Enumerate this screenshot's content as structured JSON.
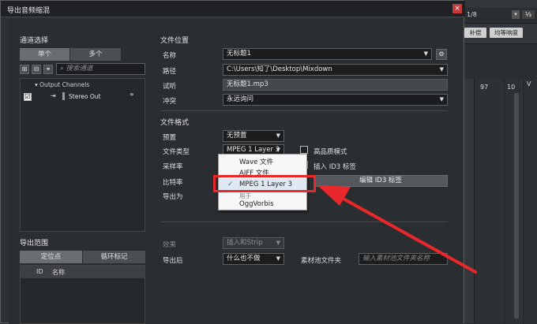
{
  "dialog": {
    "title": "导出音频缩混",
    "close_glyph": "×"
  },
  "channels": {
    "title": "通道选择",
    "mode_single": "单个",
    "mode_multi": "多个",
    "search_placeholder": "搜索通道",
    "tree_root": "Output Channels",
    "item_label": "Stereo Out",
    "item_checked": true
  },
  "range": {
    "title": "导出范围",
    "tab_locators": "定位点",
    "tab_cycle": "循环标记",
    "col_id": "ID",
    "col_name": "名称"
  },
  "location": {
    "title": "文件位置",
    "name_label": "名称",
    "name_value": "无标题1",
    "path_label": "路径",
    "path_value": "C:\\Users\\知了\\Desktop\\Mixdown",
    "preview_label": "试听",
    "preview_value": "无标题1.mp3",
    "conflict_label": "冲突",
    "conflict_value": "永远询问"
  },
  "format": {
    "title": "文件格式",
    "preset_label": "预置",
    "preset_value": "无预置",
    "type_label": "文件类型",
    "type_value": "MPEG 1 Layer 3",
    "hq_label": "高品质模式",
    "samplerate_label": "采样率",
    "id3_label": "插入 ID3 标签",
    "bitrate_label": "比特率",
    "edit_id3_label": "编辑 ID3 标签",
    "export_as_label": "导出为",
    "partial_text": "用于"
  },
  "filetype_menu": {
    "items": [
      "Wave 文件",
      "AIFF 文件",
      "MPEG 1 Layer 3",
      "OggVorbis"
    ],
    "selected_index": 2,
    "check_glyph": "✓"
  },
  "post": {
    "effects_label": "效果",
    "effects_value": "插入和Strip",
    "after_label": "导出后",
    "after_value": "什么也不做",
    "pool_label": "素材池文件夹",
    "pool_placeholder": "输入素材池文件夹名称"
  },
  "background": {
    "time_sig": "1/8",
    "btn_quantize": "补偿",
    "btn_quantize2": "均等响度",
    "ruler_num_1": "97",
    "ruler_num_2": "10",
    "ruler_num_3": "V"
  },
  "colors": {
    "accent_red": "#e8282a",
    "menu_check": "#3b6fb5"
  }
}
